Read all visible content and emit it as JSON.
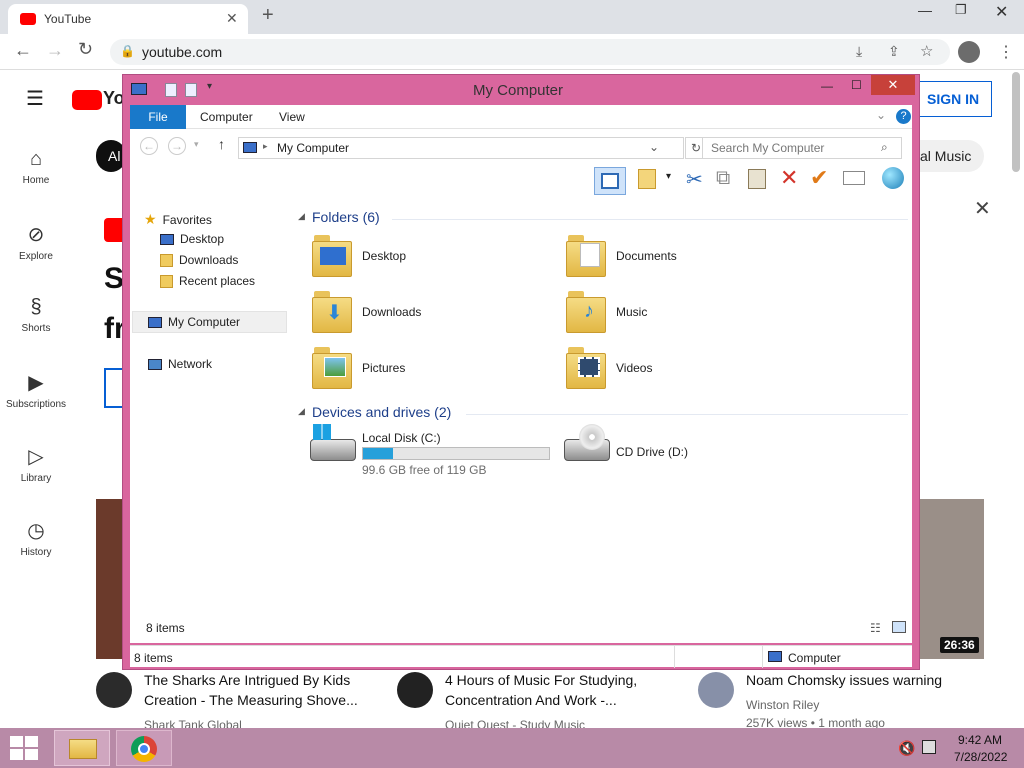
{
  "browser": {
    "tab_title": "YouTube",
    "url": "youtube.com"
  },
  "youtube": {
    "sign_in": "SIGN IN",
    "chip_all": "Al",
    "chip_music": "al Music",
    "side": [
      {
        "label": "Home",
        "icon": "home-icon"
      },
      {
        "label": "Explore",
        "icon": "compass-icon"
      },
      {
        "label": "Shorts",
        "icon": "shorts-icon"
      },
      {
        "label": "Subscriptions",
        "icon": "subscriptions-icon"
      },
      {
        "label": "Library",
        "icon": "library-icon"
      },
      {
        "label": "History",
        "icon": "history-icon"
      }
    ],
    "videos": [
      {
        "title_1": "The Sharks Are Intrigued By Kids",
        "title_2": "Creation - The Measuring Shove...",
        "channel": "Shark Tank Global"
      },
      {
        "title_1": "4 Hours of Music For Studying,",
        "title_2": "Concentration And Work -...",
        "channel": "Quiet Quest - Study Music"
      },
      {
        "title_1": "Noam Chomsky issues warning",
        "title_2": "Winston Riley",
        "channel": "257K views • 1 month ago"
      }
    ],
    "duration": "26:36"
  },
  "explorer": {
    "title": "My Computer",
    "ribbon_tabs": [
      "File",
      "Computer",
      "View"
    ],
    "path": "My Computer",
    "search_placeholder": "Search My Computer",
    "nav": {
      "favorites": "Favorites",
      "desktop": "Desktop",
      "downloads": "Downloads",
      "recent": "Recent places",
      "mycomputer": "My Computer",
      "network": "Network"
    },
    "folders_header": "Folders (6)",
    "folders": [
      "Desktop",
      "Documents",
      "Downloads",
      "Music",
      "Pictures",
      "Videos"
    ],
    "devices_header": "Devices and drives (2)",
    "local_disk": "Local Disk (C:)",
    "local_free": "99.6 GB free of 119 GB",
    "local_used_fraction": 0.16,
    "cd_drive": "CD Drive (D:)",
    "items_count": "8 items",
    "status_items": "8 items",
    "status_location": "Computer"
  },
  "taskbar": {
    "time": "9:42 AM",
    "date": "7/28/2022"
  }
}
